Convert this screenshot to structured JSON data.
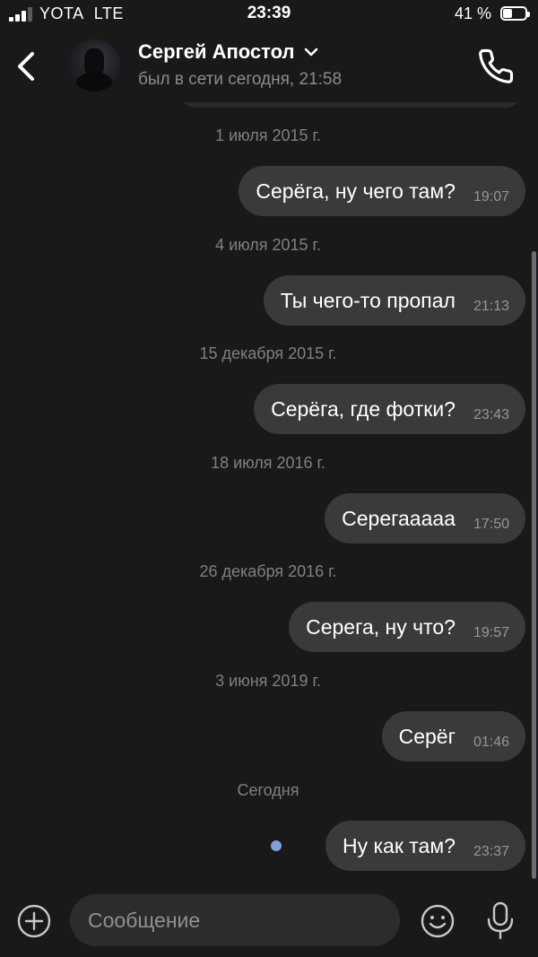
{
  "status_bar": {
    "carrier": "YOTA",
    "network": "LTE",
    "time": "23:39",
    "battery_percent_label": "41 %",
    "battery_level": 0.41,
    "signal_bars_active": 3,
    "signal_bars_total": 4
  },
  "header": {
    "contact_name": "Сергей Апостол",
    "last_seen": "был в сети сегодня, 21:58",
    "icons": [
      "back-icon",
      "chevron-down-icon",
      "phone-icon"
    ]
  },
  "messages": [
    {
      "date": "1 июля 2015 г.",
      "text": "Серёга, ну чего там?",
      "time": "19:07",
      "unread": false
    },
    {
      "date": "4 июля 2015 г.",
      "text": "Ты чего-то пропал",
      "time": "21:13",
      "unread": false
    },
    {
      "date": "15 декабря 2015 г.",
      "text": "Серёга, где фотки?",
      "time": "23:43",
      "unread": false
    },
    {
      "date": "18 июля 2016 г.",
      "text": "Серегааааа",
      "time": "17:50",
      "unread": false
    },
    {
      "date": "26 декабря 2016 г.",
      "text": "Серега, ну что?",
      "time": "19:57",
      "unread": false
    },
    {
      "date": "3 июня 2019 г.",
      "text": "Серёг",
      "time": "01:46",
      "unread": false
    },
    {
      "date": "Сегодня",
      "text": "Ну как там?",
      "time": "23:37",
      "unread": true
    }
  ],
  "composer": {
    "placeholder": "Сообщение",
    "icons": [
      "plus-circle-icon",
      "emoji-icon",
      "microphone-icon"
    ]
  },
  "colors": {
    "background": "#19191a",
    "bubble": "#3a3a3c",
    "input": "#2c2c2e",
    "secondary_text": "#8c8c8e",
    "unread_dot": "#7ea1d9"
  }
}
